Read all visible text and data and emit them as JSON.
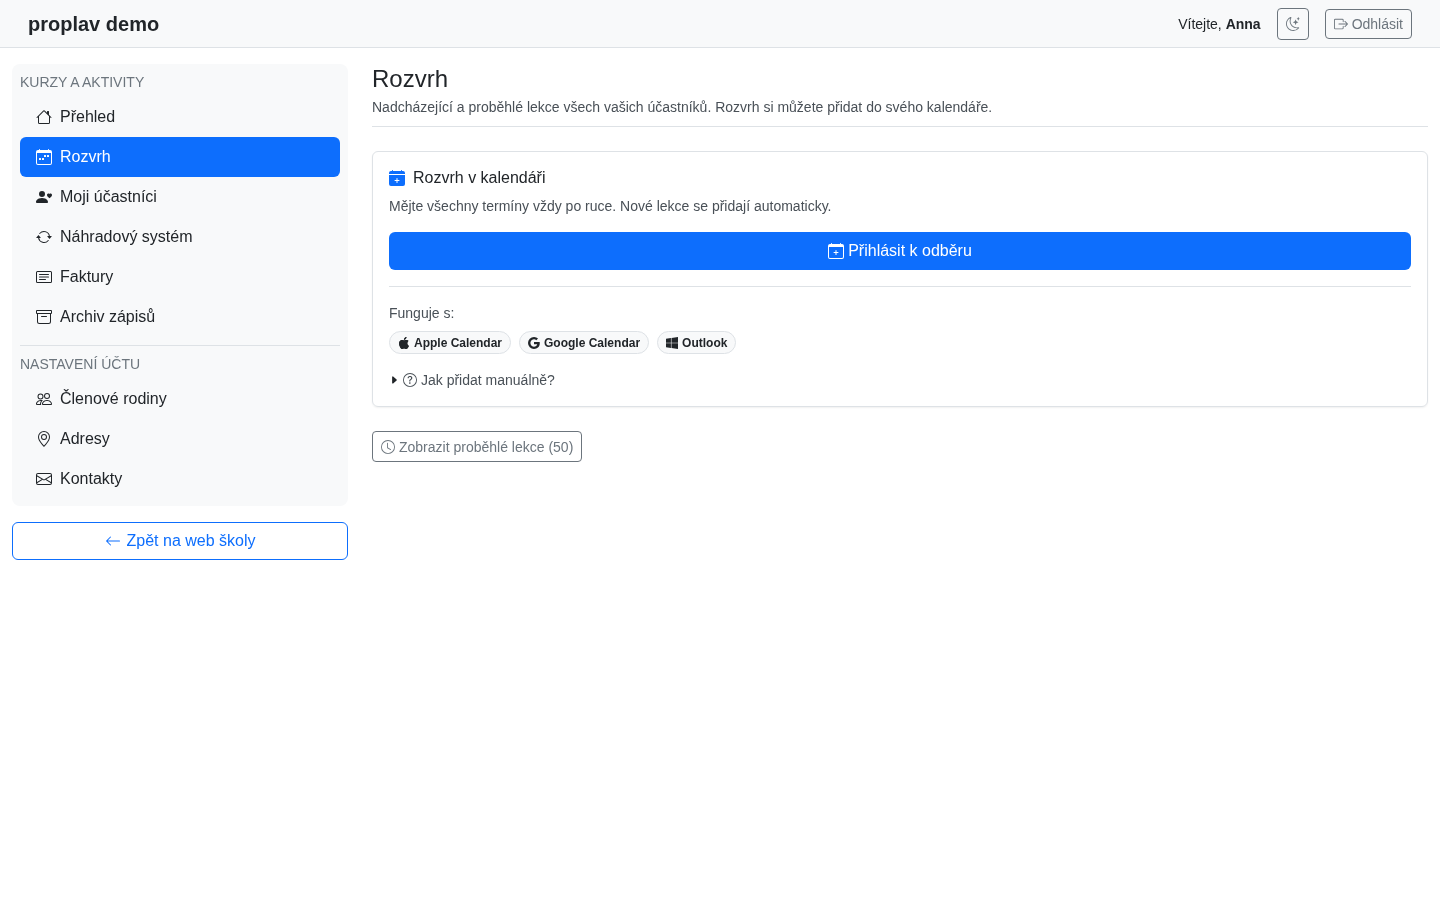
{
  "header": {
    "brand": "proplav demo",
    "greeting": "Vítejte, **Anna**",
    "logout_button": "Odhlásit"
  },
  "sidebar": {
    "sections": [
      {
        "heading": "KURZY A AKTIVITY",
        "items": [
          {
            "label": "Přehled",
            "selected": false
          },
          {
            "label": "Rozvrh",
            "selected": true
          },
          {
            "label": "Moji účastníci",
            "selected": false
          },
          {
            "label": "Náhradový systém",
            "selected": false
          },
          {
            "label": "Faktury",
            "selected": false
          },
          {
            "label": "Archiv zápisů",
            "selected": false
          }
        ]
      },
      {
        "heading": "NASTAVENÍ ÚČTU",
        "items": [
          {
            "label": "Členové rodiny",
            "selected": false
          },
          {
            "label": "Adresy",
            "selected": false
          },
          {
            "label": "Kontakty",
            "selected": false
          }
        ]
      }
    ],
    "back_button": "Zpět na web školy"
  },
  "main": {
    "title": "Rozvrh",
    "subtitle": "Nadcházející a proběhlé lekce všech vašich účastníků. Rozvrh si můžete přidat do svého kalendáře.",
    "calendar_card": {
      "title": "Rozvrh v kalendáři",
      "text": "Mějte všechny termíny vždy po ruce. Nové lekce se přidají automaticky.",
      "subscribe_button": "Přihlásit k odběru",
      "works_with_label": "Funguje s:",
      "apps": [
        "Apple Calendar",
        "Google Calendar",
        "Outlook"
      ],
      "manual_help": {
        "label": "Jak přidat manuálně?",
        "expanded": false
      }
    },
    "past_lessons_button": "Zobrazit proběhlé lekce (50)"
  }
}
